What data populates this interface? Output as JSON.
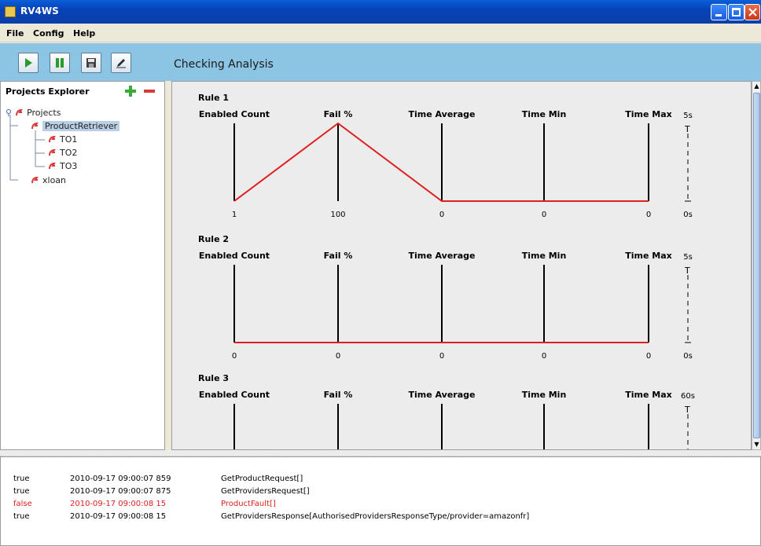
{
  "window": {
    "title": "RV4WS"
  },
  "menu": [
    "File",
    "Config",
    "Help"
  ],
  "toolbar": {
    "heading": "Checking Analysis",
    "buttons": [
      "play-icon",
      "pause-icon",
      "save-icon",
      "edit-icon"
    ]
  },
  "explorer": {
    "title": "Projects Explorer",
    "tree": [
      {
        "label": "Projects",
        "level": 0
      },
      {
        "label": "ProductRetriever",
        "level": 1,
        "selected": true
      },
      {
        "label": "TO1",
        "level": 2
      },
      {
        "label": "TO2",
        "level": 2
      },
      {
        "label": "TO3",
        "level": 2
      },
      {
        "label": "xloan",
        "level": 1
      }
    ]
  },
  "rules": [
    {
      "title": "Rule 1",
      "headers": [
        "Enabled Count",
        "Fail %",
        "Time Average",
        "Time Min",
        "Time Max"
      ],
      "values": [
        "1",
        "100",
        "0",
        "0",
        "0"
      ],
      "levels": [
        0,
        1,
        0,
        0,
        0
      ],
      "range_top": "5s",
      "range_bottom": "0s"
    },
    {
      "title": "Rule 2",
      "headers": [
        "Enabled Count",
        "Fail %",
        "Time Average",
        "Time Min",
        "Time Max"
      ],
      "values": [
        "0",
        "0",
        "0",
        "0",
        "0"
      ],
      "levels": [
        0,
        0,
        0,
        0,
        0
      ],
      "range_top": "5s",
      "range_bottom": "0s"
    },
    {
      "title": "Rule 3",
      "headers": [
        "Enabled Count",
        "Fail %",
        "Time Average",
        "Time Min",
        "Time Max"
      ],
      "values": [],
      "levels": [],
      "range_top": "60s",
      "range_bottom": ""
    }
  ],
  "log": [
    {
      "status": "true",
      "time": "2010-09-17 09:00:07 859",
      "message": "GetProductRequest[]",
      "error": false
    },
    {
      "status": "true",
      "time": "2010-09-17 09:00:07 875",
      "message": "GetProvidersRequest[]",
      "error": false
    },
    {
      "status": "false",
      "time": "2010-09-17 09:00:08 15",
      "message": "ProductFault[]",
      "error": true
    },
    {
      "status": "true",
      "time": "2010-09-17 09:00:08 15",
      "message": "GetProvidersResponse[AuthorisedProvidersResponseType/provider=amazonfr]",
      "error": false
    }
  ],
  "colors": {
    "line": "#e02020",
    "accent": "#8cc4e4"
  }
}
